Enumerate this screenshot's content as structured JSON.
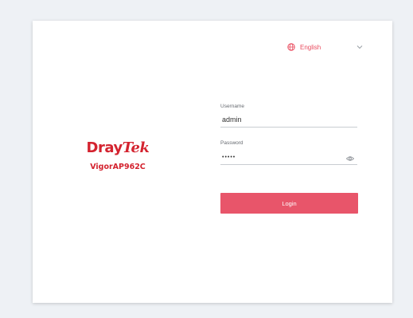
{
  "language_selector": {
    "icon": "globe-icon",
    "label": "English",
    "dropdown_icon": "chevron-down-icon"
  },
  "brand": {
    "logo_dray": "Dray",
    "logo_tek": "Tek",
    "model": "VigorAP962C"
  },
  "form": {
    "username_label": "Username",
    "username_value": "admin",
    "password_label": "Password",
    "password_value": "•••••",
    "password_toggle_icon": "eye-icon",
    "login_label": "Login"
  },
  "colors": {
    "brand_red": "#d4232f",
    "accent": "#e8556a",
    "page_bg": "#eef1f5",
    "card_bg": "#ffffff"
  }
}
